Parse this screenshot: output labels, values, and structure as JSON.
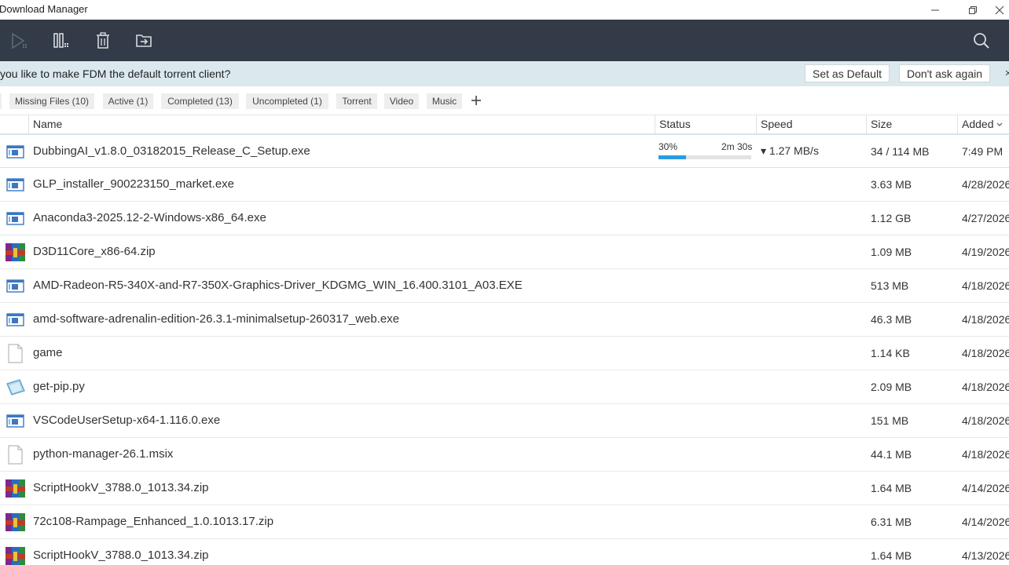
{
  "window": {
    "title": "Download Manager"
  },
  "toolbar": {
    "icons": [
      "start-icon",
      "pause-icon",
      "delete-icon",
      "move-folder-icon",
      "search-icon"
    ]
  },
  "banner": {
    "message": "you like to make FDM the default torrent client?",
    "set_default_label": "Set as Default",
    "dont_ask_label": "Don't ask again"
  },
  "filters": [
    {
      "label": "Missing Files (10)"
    },
    {
      "label": "Active (1)"
    },
    {
      "label": "Completed (13)"
    },
    {
      "label": "Uncompleted (1)"
    },
    {
      "label": "Torrent"
    },
    {
      "label": "Video"
    },
    {
      "label": "Music"
    }
  ],
  "columns": {
    "name": "Name",
    "status": "Status",
    "speed": "Speed",
    "size": "Size",
    "added": "Added"
  },
  "active_download": {
    "percent_label": "30%",
    "progress": 0.3,
    "eta": "2m 30s",
    "speed": "▾ 1.27 MB/s"
  },
  "downloads": [
    {
      "name": "DubbingAI_v1.8.0_03182015_Release_C_Setup.exe",
      "size": "34 / 114 MB",
      "added": "7:49 PM",
      "icon": "exe"
    },
    {
      "name": "GLP_installer_900223150_market.exe",
      "size": "3.63 MB",
      "added": "4/28/2026",
      "icon": "exe"
    },
    {
      "name": "Anaconda3-2025.12-2-Windows-x86_64.exe",
      "size": "1.12 GB",
      "added": "4/27/2026",
      "icon": "exe"
    },
    {
      "name": "D3D11Core_x86-64.zip",
      "size": "1.09 MB",
      "added": "4/19/2026",
      "icon": "zip"
    },
    {
      "name": "AMD-Radeon-R5-340X-and-R7-350X-Graphics-Driver_KDGMG_WIN_16.400.3101_A03.EXE",
      "size": "513 MB",
      "added": "4/18/2026",
      "icon": "exe"
    },
    {
      "name": "amd-software-adrenalin-edition-26.3.1-minimalsetup-260317_web.exe",
      "size": "46.3 MB",
      "added": "4/18/2026",
      "icon": "exe"
    },
    {
      "name": "game",
      "size": "1.14 KB",
      "added": "4/18/2026",
      "icon": "blank"
    },
    {
      "name": "get-pip.py",
      "size": "2.09 MB",
      "added": "4/18/2026",
      "icon": "py"
    },
    {
      "name": "VSCodeUserSetup-x64-1.116.0.exe",
      "size": "151 MB",
      "added": "4/18/2026",
      "icon": "exe"
    },
    {
      "name": "python-manager-26.1.msix",
      "size": "44.1 MB",
      "added": "4/18/2026",
      "icon": "blank"
    },
    {
      "name": "ScriptHookV_3788.0_1013.34.zip",
      "size": "1.64 MB",
      "added": "4/14/2026",
      "icon": "zip"
    },
    {
      "name": "72c108-Rampage_Enhanced_1.0.1013.17.zip",
      "size": "6.31 MB",
      "added": "4/14/2026",
      "icon": "zip"
    },
    {
      "name": "ScriptHookV_3788.0_1013.34.zip",
      "size": "1.64 MB",
      "added": "4/13/2026",
      "icon": "zip"
    }
  ]
}
